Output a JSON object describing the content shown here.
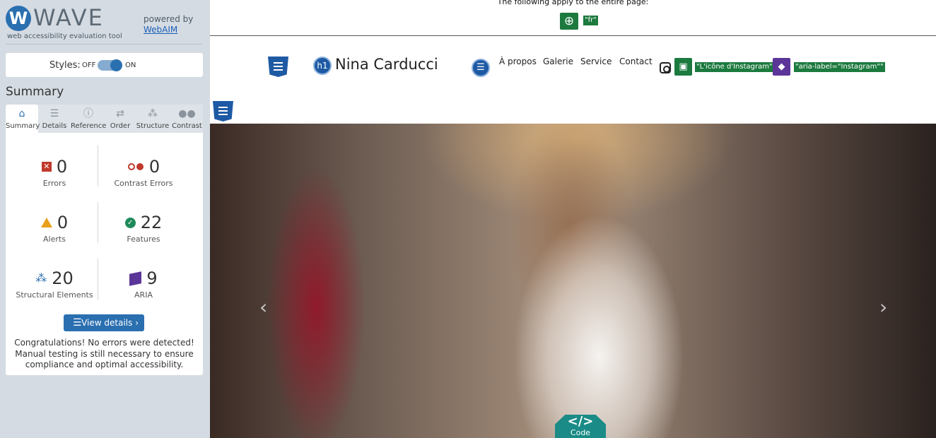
{
  "wave": {
    "logo_letter": "W",
    "logo_word": "WAVE",
    "logo_subtitle": "web accessibility evaluation tool",
    "powered_by": "powered by",
    "powered_link": "WebAIM"
  },
  "styles": {
    "label": "Styles:",
    "off": "OFF",
    "on": "ON",
    "state": "on"
  },
  "summary_heading": "Summary",
  "tabs": [
    {
      "label": "Summary",
      "icon": "home-icon",
      "active": true
    },
    {
      "label": "Details",
      "icon": "list-icon"
    },
    {
      "label": "Reference",
      "icon": "info-icon"
    },
    {
      "label": "Order",
      "icon": "order-icon"
    },
    {
      "label": "Structure",
      "icon": "structure-icon"
    },
    {
      "label": "Contrast",
      "icon": "contrast-icon"
    }
  ],
  "stats": {
    "errors": {
      "value": "0",
      "label": "Errors"
    },
    "contrast": {
      "value": "0",
      "label": "Contrast Errors"
    },
    "alerts": {
      "value": "0",
      "label": "Alerts"
    },
    "features": {
      "value": "22",
      "label": "Features"
    },
    "structural": {
      "value": "20",
      "label": "Structural Elements"
    },
    "aria": {
      "value": "9",
      "label": "ARIA"
    }
  },
  "view_details": "View details ›",
  "congrats": "Congratulations! No errors were detected! Manual testing is still necessary to ensure compliance and optimal accessibility.",
  "page": {
    "topbar_text": "The following apply to the entire page:",
    "lang_badge": "\"fr\"",
    "site_title": "Nina Carducci",
    "h1_badge": "h1",
    "nav": [
      "À propos",
      "Galerie",
      "Service",
      "Contact"
    ],
    "alt_badge": "\"L'icône d'Instagram\"",
    "aria_badge": "\"aria-label=\"Instagram\"\"",
    "code_symbol": "</>",
    "code_label": "Code"
  },
  "colors": {
    "wave_blue": "#2a6fb0",
    "error_red": "#c0392b",
    "alert_orange": "#e8a11b",
    "feature_green": "#1f8a5a",
    "aria_purple": "#5b3598",
    "code_teal": "#1a8b86"
  }
}
